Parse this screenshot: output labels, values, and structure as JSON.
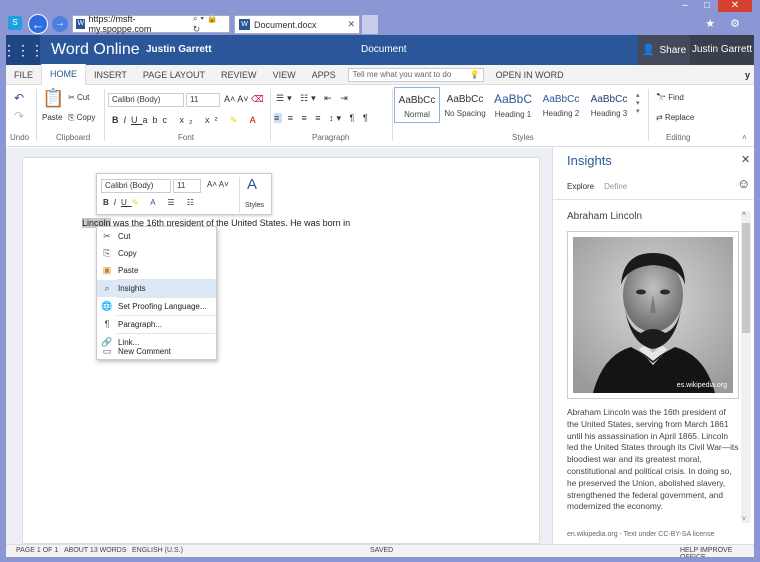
{
  "browser": {
    "url": "https://msft-my.spoppe.com",
    "tab_title": "Document.docx",
    "win_controls": [
      "–",
      "□",
      "✕"
    ],
    "right_icons": "★ ⚙"
  },
  "app": {
    "name": "Word Online",
    "user": "Justin Garrett",
    "doc_title": "Document",
    "share": "Share",
    "user_right": "Justin Garrett"
  },
  "ribbon_tabs": [
    "FILE",
    "HOME",
    "INSERT",
    "PAGE LAYOUT",
    "REVIEW",
    "VIEW",
    "APPS"
  ],
  "tell_me": "Tell me what you want to do",
  "open_in_word": "OPEN IN WORD",
  "ys": "y̤",
  "ribbon": {
    "undo_label": "Undo",
    "clipboard_label": "Clipboard",
    "paste": "Paste",
    "cut": "Cut",
    "copy": "Copy",
    "font_name": "Calibri (Body)",
    "font_size": "11",
    "font_label": "Font",
    "paragraph_label": "Paragraph",
    "styles_label": "Styles",
    "editing_label": "Editing",
    "find": "Find",
    "replace": "Replace",
    "styles": [
      {
        "sample": "AaBbCc",
        "name": "Normal"
      },
      {
        "sample": "AaBbCc",
        "name": "No Spacing"
      },
      {
        "sample": "AaBbC",
        "name": "Heading 1"
      },
      {
        "sample": "AaBbCc",
        "name": "Heading 2"
      },
      {
        "sample": "AaBbCc",
        "name": "Heading 3"
      }
    ]
  },
  "mini_toolbar": {
    "font": "Calibri (Body)",
    "size": "11",
    "styles": "Styles"
  },
  "doc": {
    "selected": "Lincoln",
    "rest": " was the 16th president of the United States. He was born in"
  },
  "context_menu": [
    "Cut",
    "Copy",
    "Paste",
    "Insights",
    "Set Proofing Language...",
    "Paragraph...",
    "Link...",
    "New Comment"
  ],
  "insights": {
    "title": "Insights",
    "tab_explore": "Explore",
    "tab_define": "Define",
    "name": "Abraham Lincoln",
    "photo_caption": "es.wikipedia.org",
    "text": "Abraham Lincoln was the 16th president of the United States, serving from March 1861 until his assassination in April 1865. Lincoln led the United States through its Civil War—its bloodiest war and its greatest moral, constitutional and political crisis. In doing so, he preserved the Union, abolished slavery, strengthened the federal government, and modernized the economy.",
    "footer": "en.wikipedia.org - Text under CC-BY-SA license"
  },
  "status": {
    "page": "PAGE 1 OF 1",
    "words": "ABOUT 13 WORDS",
    "lang": "ENGLISH (U.S.)",
    "saved": "SAVED",
    "help": "HELP IMPROVE OFFICE"
  }
}
